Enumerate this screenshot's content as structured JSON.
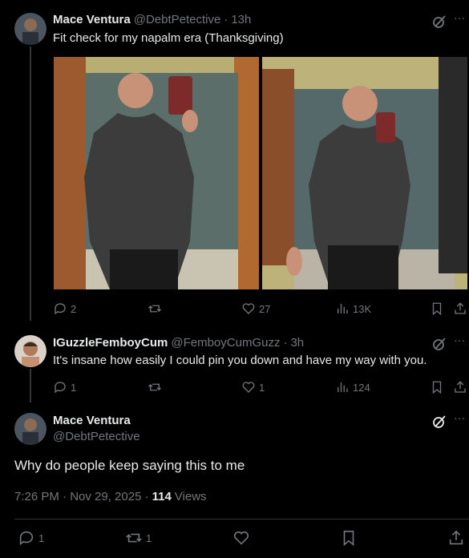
{
  "post1": {
    "name": "Mace Ventura",
    "handle": "@DebtPetective",
    "sep": "·",
    "time": "13h",
    "text": "Fit check for my napalm era (Thanksgiving)",
    "replies": "2",
    "reposts": "",
    "likes": "27",
    "views": "13K"
  },
  "post2": {
    "name": "IGuzzleFemboyCum",
    "handle": "@FemboyCumGuzz",
    "sep": "·",
    "time": "3h",
    "text": "It's insane how easily I could pin you down and have my way with you.",
    "replies": "1",
    "reposts": "",
    "likes": "1",
    "views": "124"
  },
  "post3": {
    "name": "Mace Ventura",
    "handle": "@DebtPetective",
    "text": "Why do people keep saying this to me",
    "timestamp": "7:26 PM · Nov 29, 2025 ·",
    "views_count": "114",
    "views_label": "Views",
    "replies": "1",
    "reposts": "1",
    "likes": ""
  },
  "icons": {
    "more": "···"
  }
}
